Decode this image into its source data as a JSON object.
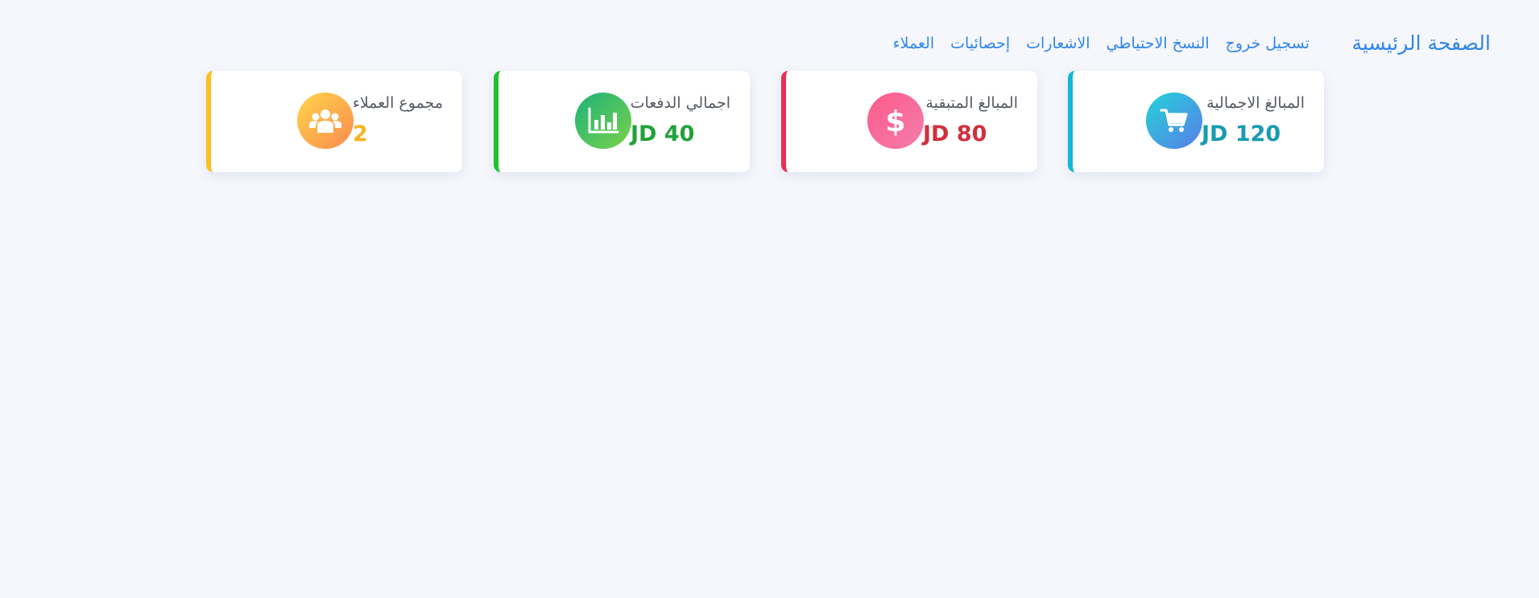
{
  "navbar": {
    "brand": "الصفحة الرئيسية",
    "links": [
      {
        "label": "العملاء"
      },
      {
        "label": "إحصائيات"
      },
      {
        "label": "الاشعارات"
      },
      {
        "label": "النسخ الاحتياطي"
      },
      {
        "label": "تسجيل خروج"
      }
    ]
  },
  "cards": [
    {
      "label": "المبالغ الاجمالية",
      "value": "JD 120",
      "icon": "shopping-cart-icon",
      "accent": "#12b8d6",
      "value_color": "#1a9bb0",
      "gradient": [
        "#22d3d9",
        "#5a7de8"
      ]
    },
    {
      "label": "المبالغ المتبقية",
      "value": "JD 80",
      "icon": "dollar-icon",
      "accent": "#e53250",
      "value_color": "#d0303f",
      "gradient": [
        "#fb5a8a",
        "#f57dab"
      ]
    },
    {
      "label": "اجمالي الدفعات",
      "value": "JD 40",
      "icon": "bar-chart-icon",
      "accent": "#1fc12e",
      "value_color": "#21a23a",
      "gradient": [
        "#1db27a",
        "#7ad24a"
      ]
    },
    {
      "label": "مجموع العملاء",
      "value": "2",
      "icon": "users-icon",
      "accent": "#ffbf1a",
      "value_color": "#f6b422",
      "gradient": [
        "#ffd54a",
        "#fb8a50"
      ]
    }
  ]
}
